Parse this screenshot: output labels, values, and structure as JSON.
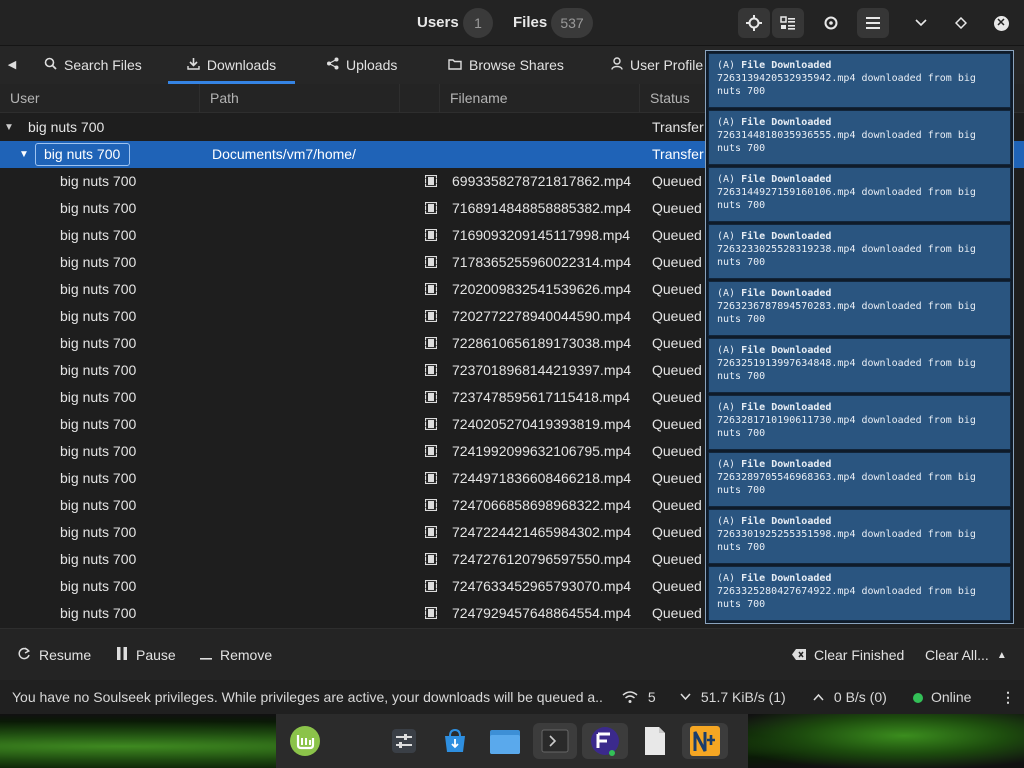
{
  "header": {
    "users_label": "Users",
    "users_count": "1",
    "files_label": "Files",
    "files_count": "537"
  },
  "tabs": [
    {
      "label": "Search Files",
      "icon": "search-icon"
    },
    {
      "label": "Downloads",
      "icon": "download-icon"
    },
    {
      "label": "Uploads",
      "icon": "share-icon"
    },
    {
      "label": "Browse Shares",
      "icon": "folder-icon"
    },
    {
      "label": "User Profile",
      "icon": "user-icon"
    }
  ],
  "table": {
    "columns": [
      "User",
      "Path",
      "Filename",
      "Status"
    ],
    "group_row": {
      "user": "big nuts 700",
      "status": "Transfer"
    },
    "folder_row": {
      "user": "big nuts 700",
      "path": "Documents/vm7/home/",
      "status": "Transfer"
    },
    "rows": [
      {
        "user": "big nuts 700",
        "filename": "6993358278721817862.mp4",
        "status": "Queued"
      },
      {
        "user": "big nuts 700",
        "filename": "7168914848858885382.mp4",
        "status": "Queued"
      },
      {
        "user": "big nuts 700",
        "filename": "7169093209145117998.mp4",
        "status": "Queued"
      },
      {
        "user": "big nuts 700",
        "filename": "7178365255960022314.mp4",
        "status": "Queued"
      },
      {
        "user": "big nuts 700",
        "filename": "7202009832541539626.mp4",
        "status": "Queued"
      },
      {
        "user": "big nuts 700",
        "filename": "7202772278940044590.mp4",
        "status": "Queued"
      },
      {
        "user": "big nuts 700",
        "filename": "7228610656189173038.mp4",
        "status": "Queued"
      },
      {
        "user": "big nuts 700",
        "filename": "7237018968144219397.mp4",
        "status": "Queued"
      },
      {
        "user": "big nuts 700",
        "filename": "7237478595617115418.mp4",
        "status": "Queued"
      },
      {
        "user": "big nuts 700",
        "filename": "7240205270419393819.mp4",
        "status": "Queued"
      },
      {
        "user": "big nuts 700",
        "filename": "7241992099632106795.mp4",
        "status": "Queued"
      },
      {
        "user": "big nuts 700",
        "filename": "7244971836608466218.mp4",
        "status": "Queued"
      },
      {
        "user": "big nuts 700",
        "filename": "7247066858698968322.mp4",
        "status": "Queued"
      },
      {
        "user": "big nuts 700",
        "filename": "7247224421465984302.mp4",
        "status": "Queued"
      },
      {
        "user": "big nuts 700",
        "filename": "7247276120796597550.mp4",
        "status": "Queued"
      },
      {
        "user": "big nuts 700",
        "filename": "7247633452965793070.mp4",
        "status": "Queued"
      },
      {
        "user": "big nuts 700",
        "filename": "7247929457648864554.mp4",
        "status": "Queued"
      }
    ]
  },
  "actions": {
    "resume": "Resume",
    "pause": "Pause",
    "remove": "Remove",
    "clear_finished": "Clear Finished",
    "clear_all": "Clear All..."
  },
  "status": {
    "message": "You have no Soulseek privileges. While privileges are active, your downloads will be queued a...",
    "connections": "5",
    "download_speed": "51.7 KiB/s (1)",
    "upload_speed": "0 B/s (0)",
    "online": "Online"
  },
  "notifications": [
    {
      "title": "File Downloaded",
      "prefix": "(A)",
      "body": "7263139420532935942.mp4 downloaded from big nuts 700"
    },
    {
      "title": "File Downloaded",
      "prefix": "(A)",
      "body": "7263144818035936555.mp4 downloaded from big nuts 700"
    },
    {
      "title": "File Downloaded",
      "prefix": "(A)",
      "body": "7263144927159160106.mp4 downloaded from big nuts 700"
    },
    {
      "title": "File Downloaded",
      "prefix": "(A)",
      "body": "7263233025528319238.mp4 downloaded from big nuts 700"
    },
    {
      "title": "File Downloaded",
      "prefix": "(A)",
      "body": "7263236787894570283.mp4 downloaded from big nuts 700"
    },
    {
      "title": "File Downloaded",
      "prefix": "(A)",
      "body": "7263251913997634848.mp4 downloaded from big nuts 700"
    },
    {
      "title": "File Downloaded",
      "prefix": "(A)",
      "body": "7263281710190611730.mp4 downloaded from big nuts 700"
    },
    {
      "title": "File Downloaded",
      "prefix": "(A)",
      "body": "7263289705546968363.mp4 downloaded from big nuts 700"
    },
    {
      "title": "File Downloaded",
      "prefix": "(A)",
      "body": "7263301925255351598.mp4 downloaded from big nuts 700"
    },
    {
      "title": "File Downloaded",
      "prefix": "(A)",
      "body": "7263325280427674922.mp4 downloaded from big nuts 700"
    }
  ],
  "colors": {
    "accent": "#3584e4",
    "selected_row": "#1f63b7",
    "notification_bg": "#2a5580",
    "online": "#33c057"
  }
}
